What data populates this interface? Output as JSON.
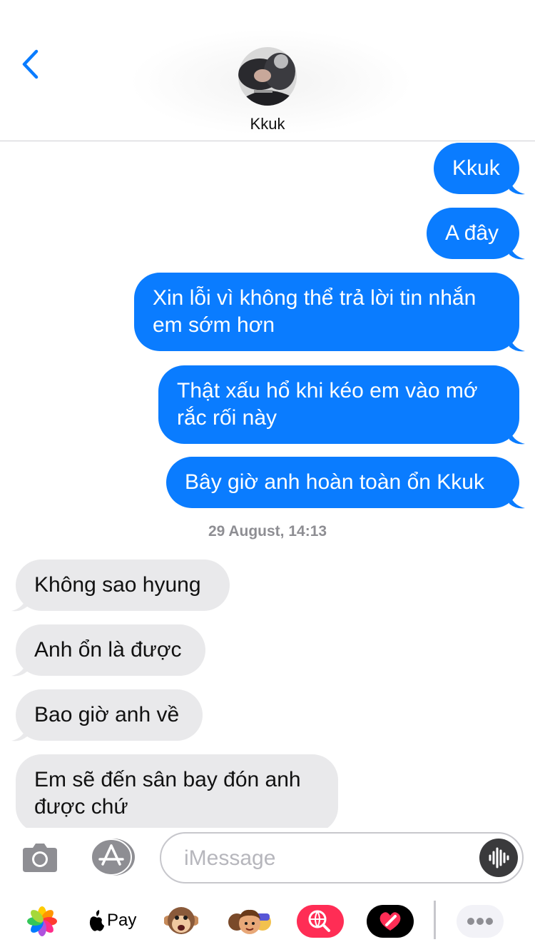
{
  "status_bar": {
    "battery_color": "#ffcc00"
  },
  "header": {
    "back_icon": "chevron-left-icon",
    "contact_name": "Kkuk",
    "avatar": "contact-avatar-photo"
  },
  "messages_before": [
    {
      "direction": "outgoing",
      "lines": [
        "Kkuk"
      ]
    },
    {
      "direction": "outgoing",
      "lines": [
        "A đây"
      ]
    },
    {
      "direction": "outgoing",
      "lines": [
        "Xin lỗi vì không thể trả lời tin nhắn",
        "em sớm hơn"
      ]
    },
    {
      "direction": "outgoing",
      "lines": [
        "Thật xấu hổ khi kéo em vào mớ",
        "rắc rối này"
      ]
    },
    {
      "direction": "outgoing",
      "lines": [
        "Bây giờ anh hoàn toàn ổn Kkuk"
      ]
    }
  ],
  "timestamp": "29 August, 14:13",
  "messages_after": [
    {
      "direction": "incoming",
      "lines": [
        "Không sao hyung"
      ]
    },
    {
      "direction": "incoming",
      "lines": [
        "Anh ổn là được"
      ]
    },
    {
      "direction": "incoming",
      "lines": [
        "Bao giờ anh về"
      ]
    },
    {
      "direction": "incoming",
      "lines": [
        "Em sẽ đến sân bay đón anh",
        "được chứ"
      ]
    }
  ],
  "composer": {
    "camera_icon": "camera-icon",
    "apps_icon": "app-store-icon",
    "placeholder": "iMessage",
    "value": "",
    "voice_icon": "waveform-icon"
  },
  "app_drawer": {
    "items": [
      {
        "name": "photos-app",
        "icon": "photos-icon"
      },
      {
        "name": "apple-pay-app",
        "icon": "apple-logo-icon",
        "label": "Pay"
      },
      {
        "name": "animoji-app",
        "icon": "monkey-memoji-icon"
      },
      {
        "name": "memoji-stickers-app",
        "icon": "memoji-stickers-icon"
      },
      {
        "name": "images-search-app",
        "icon": "globe-search-icon"
      },
      {
        "name": "digital-touch-app",
        "icon": "heart-touch-icon"
      },
      {
        "name": "more-apps",
        "icon": "ellipsis-icon"
      }
    ]
  },
  "colors": {
    "outgoing_bubble": "#0a7cff",
    "incoming_bubble": "#e9e9eb",
    "accent": "#0a7cff",
    "timestamp": "#8e8e93"
  }
}
